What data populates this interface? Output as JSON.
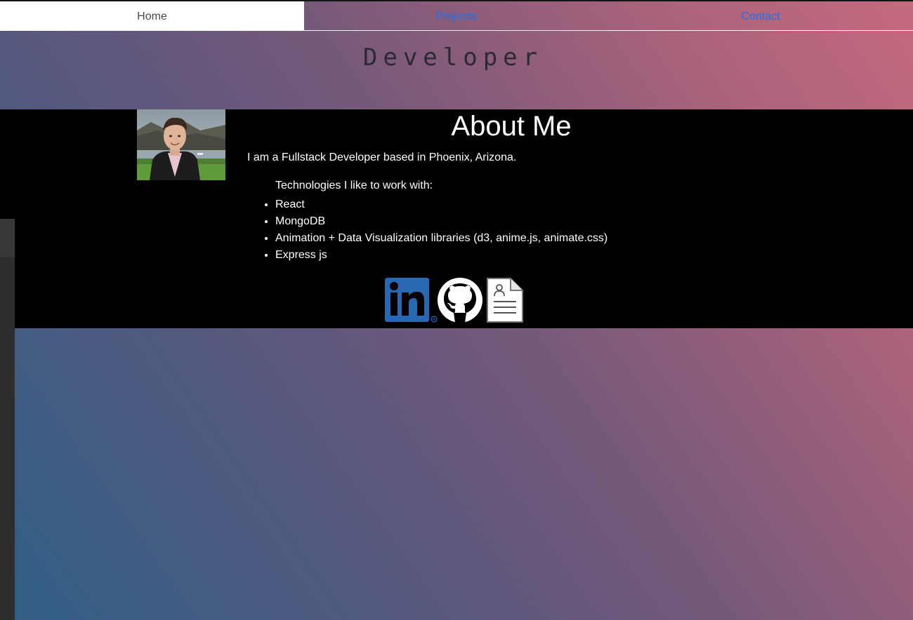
{
  "nav": {
    "tabs": [
      {
        "label": "Home",
        "active": true
      },
      {
        "label": "Projects",
        "active": false
      },
      {
        "label": "Contact",
        "active": false
      }
    ]
  },
  "header": {
    "title": "Developer"
  },
  "about": {
    "heading": "About Me",
    "intro": "I am a Fullstack Developer based in Phoenix, Arizona.",
    "tech_label": "Technologies I like to work with:",
    "technologies": [
      "React",
      "MongoDB",
      "Animation + Data Visualization libraries (d3, anime.js, animate.css)",
      "Express js"
    ]
  },
  "social": {
    "icons": [
      "linkedin-icon",
      "github-icon",
      "resume-icon"
    ]
  },
  "colors": {
    "link": "#1a73f0",
    "linkedin": "#2867b2",
    "panel": "#000000"
  }
}
